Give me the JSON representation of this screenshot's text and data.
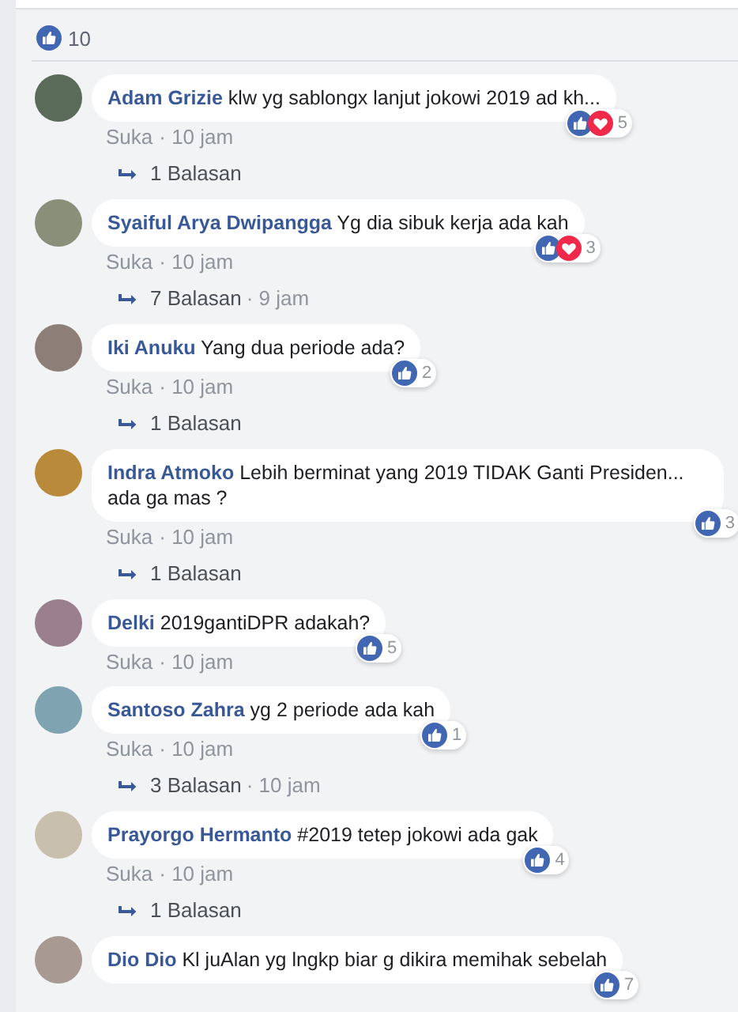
{
  "reactions_summary": {
    "icons": [
      {
        "kind": "like"
      }
    ],
    "count": "10"
  },
  "comments": [
    {
      "author": "Adam Grizie",
      "text": "klw yg sablongx lanjut jokowi 2019 ad kh...",
      "reactions": [
        {
          "kind": "like"
        },
        {
          "kind": "love"
        }
      ],
      "reaction_count": "5",
      "like_label": "Suka",
      "time": "· 10 jam",
      "replies": {
        "label": "1 Balasan"
      }
    },
    {
      "author": "Syaiful Arya Dwipangga",
      "text": "Yg dia sibuk kerja ada kah",
      "reactions": [
        {
          "kind": "like"
        },
        {
          "kind": "love"
        }
      ],
      "reaction_count": "3",
      "like_label": "Suka",
      "time": "· 10 jam",
      "replies": {
        "label": "7 Balasan",
        "time": "· 9 jam"
      }
    },
    {
      "author": "Iki Anuku",
      "text": "Yang dua periode ada?",
      "reactions": [
        {
          "kind": "like"
        }
      ],
      "reaction_count": "2",
      "like_label": "Suka",
      "time": "· 10 jam",
      "replies": {
        "label": "1 Balasan"
      }
    },
    {
      "author": "Indra Atmoko",
      "text": "Lebih berminat yang 2019 TIDAK Ganti Presiden... ada ga mas ?",
      "reactions": [
        {
          "kind": "like"
        }
      ],
      "reaction_count": "3",
      "like_label": "Suka",
      "time": "· 10 jam",
      "replies": {
        "label": "1 Balasan"
      }
    },
    {
      "author": "Delki",
      "text": "2019gantiDPR adakah?",
      "reactions": [
        {
          "kind": "like"
        }
      ],
      "reaction_count": "5",
      "like_label": "Suka",
      "time": "· 10 jam"
    },
    {
      "author": "Santoso Zahra",
      "text": "yg 2 periode ada kah",
      "reactions": [
        {
          "kind": "like"
        }
      ],
      "reaction_count": "1",
      "like_label": "Suka",
      "time": "· 10 jam",
      "replies": {
        "label": "3 Balasan",
        "time": "· 10 jam"
      }
    },
    {
      "author": "Prayorgo Hermanto",
      "text": "#2019 tetep jokowi ada gak",
      "reactions": [
        {
          "kind": "like"
        }
      ],
      "reaction_count": "4",
      "like_label": "Suka",
      "time": "· 10 jam",
      "replies": {
        "label": "1 Balasan"
      }
    },
    {
      "author": "Dio Dio",
      "text": "Kl juAlan yg lngkp biar g dikira memihak sebelah",
      "reactions": [
        {
          "kind": "like"
        }
      ],
      "reaction_count": "7"
    }
  ]
}
